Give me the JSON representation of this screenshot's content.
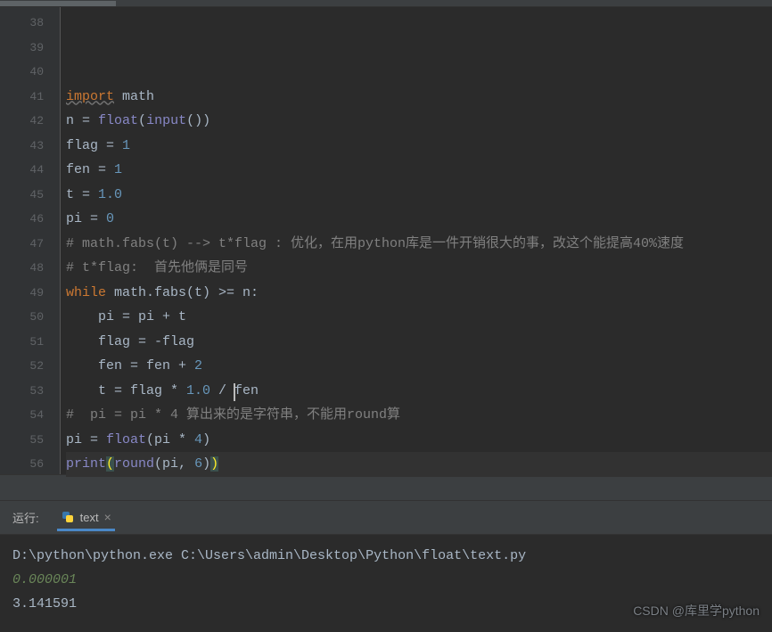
{
  "editor": {
    "first_line": 38,
    "last_line": 56,
    "current_line": 53,
    "lines": [
      {
        "n": 38,
        "tokens": [
          [
            "kw-u",
            "import"
          ],
          [
            "ident",
            " "
          ],
          [
            "ident",
            "math"
          ]
        ]
      },
      {
        "n": 39,
        "tokens": [
          [
            "ident",
            "n "
          ],
          [
            "ident",
            "= "
          ],
          [
            "builtin",
            "float"
          ],
          [
            "ident",
            "("
          ],
          [
            "builtin",
            "input"
          ],
          [
            "ident",
            "())"
          ]
        ]
      },
      {
        "n": 40,
        "tokens": [
          [
            "ident",
            "flag = "
          ],
          [
            "num",
            "1"
          ]
        ]
      },
      {
        "n": 41,
        "tokens": [
          [
            "ident",
            "fen = "
          ],
          [
            "num",
            "1"
          ]
        ]
      },
      {
        "n": 42,
        "tokens": [
          [
            "ident",
            "t = "
          ],
          [
            "num",
            "1.0"
          ]
        ]
      },
      {
        "n": 43,
        "tokens": [
          [
            "ident",
            "pi = "
          ],
          [
            "num",
            "0"
          ]
        ]
      },
      {
        "n": 44,
        "tokens": [
          [
            "comment",
            "# math.fabs(t) --> t*flag : 优化，在用python库是一件开销很大的事，改这个能提高40%速度"
          ]
        ]
      },
      {
        "n": 45,
        "tokens": [
          [
            "comment",
            "# t*flag:  首先他俩是同号"
          ]
        ]
      },
      {
        "n": 46,
        "tokens": [
          [
            "kw",
            "while "
          ],
          [
            "ident",
            "math.fabs(t) >= n:"
          ]
        ]
      },
      {
        "n": 47,
        "tokens": [
          [
            "ident",
            "    pi = pi + t"
          ]
        ]
      },
      {
        "n": 48,
        "tokens": [
          [
            "ident",
            "    flag = -flag"
          ]
        ]
      },
      {
        "n": 49,
        "tokens": [
          [
            "ident",
            "    fen = fen + "
          ],
          [
            "num",
            "2"
          ]
        ]
      },
      {
        "n": 50,
        "tokens": [
          [
            "ident",
            "    t = flag * "
          ],
          [
            "num",
            "1.0"
          ],
          [
            "ident",
            " / fen"
          ]
        ]
      },
      {
        "n": 51,
        "tokens": [
          [
            "comment",
            "#  pi = pi * 4 算出来的是字符串，不能用round算"
          ]
        ]
      },
      {
        "n": 52,
        "tokens": [
          [
            "ident",
            "pi = "
          ],
          [
            "builtin",
            "float"
          ],
          [
            "ident",
            "(pi * "
          ],
          [
            "num",
            "4"
          ],
          [
            "ident",
            ")"
          ]
        ]
      },
      {
        "n": 53,
        "tokens": [
          [
            "builtin",
            "print"
          ],
          [
            "bracket-hl",
            "("
          ],
          [
            "builtin",
            "round"
          ],
          [
            "ident",
            "(pi"
          ],
          [
            "ident",
            ", "
          ],
          [
            "num",
            "6"
          ],
          [
            "ident",
            ")"
          ],
          [
            "bracket-hl",
            ")"
          ]
        ],
        "hl": true
      },
      {
        "n": 54,
        "tokens": []
      },
      {
        "n": 55,
        "tokens": []
      },
      {
        "n": 56,
        "tokens": []
      }
    ]
  },
  "run": {
    "panel_label": "运行:",
    "tab_name": "text",
    "output": [
      {
        "cls": "ident",
        "text": "D:\\python\\python.exe C:\\Users\\admin\\Desktop\\Python\\float\\text.py"
      },
      {
        "cls": "input-echo",
        "text": "0.000001"
      },
      {
        "cls": "ident",
        "text": "3.141591"
      }
    ]
  },
  "watermark": "CSDN @库里学python"
}
